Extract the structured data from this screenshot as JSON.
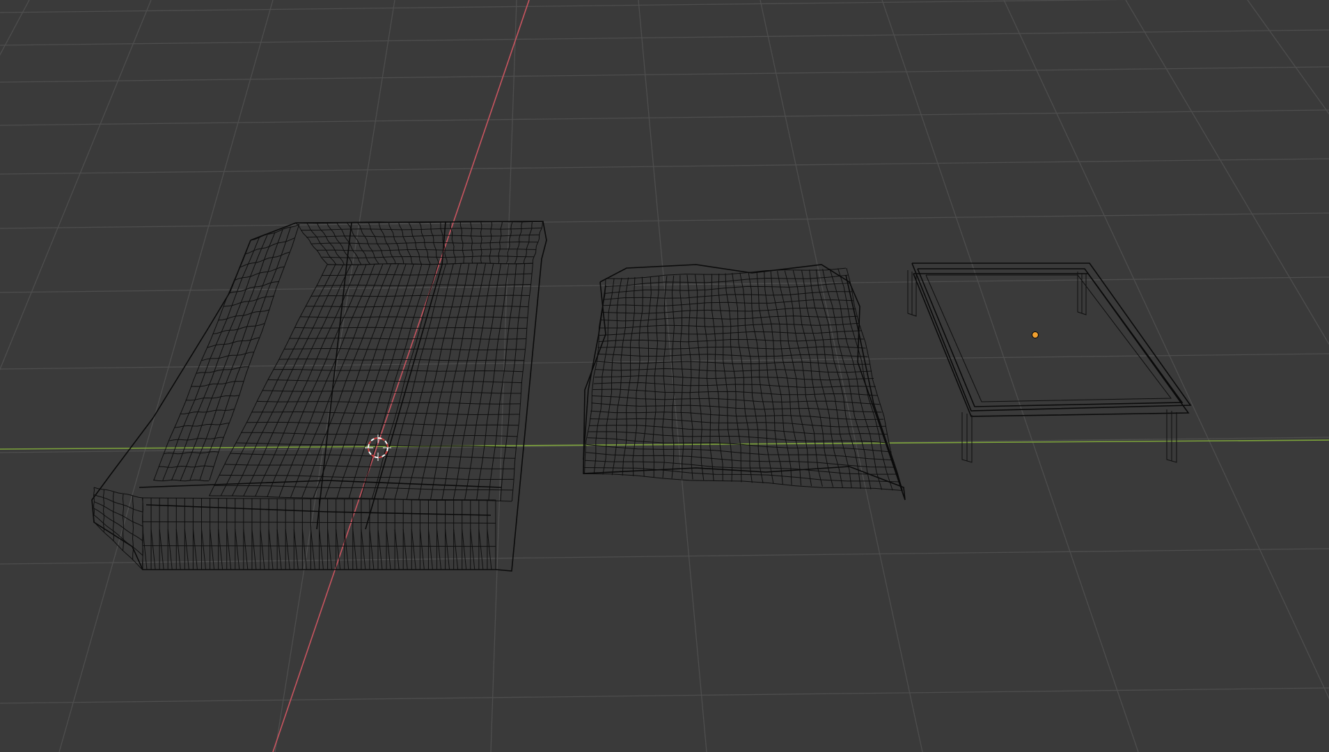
{
  "viewport": {
    "mode": "wireframe",
    "background": "#3a3a3a",
    "grid_color": "#4e4e4e",
    "axis_x_color": "#c95560",
    "axis_y_color": "#7da43a",
    "wire_color": "#0e0e0e",
    "origin_color": "#f0a030"
  },
  "objects": [
    {
      "name": "sofa",
      "icon": "sectional-sofa"
    },
    {
      "name": "blanket",
      "icon": "cloth"
    },
    {
      "name": "coffee-table",
      "icon": "table",
      "selected_origin": true
    }
  ],
  "cursor_3d": {
    "icon": "3d-cursor-icon"
  }
}
